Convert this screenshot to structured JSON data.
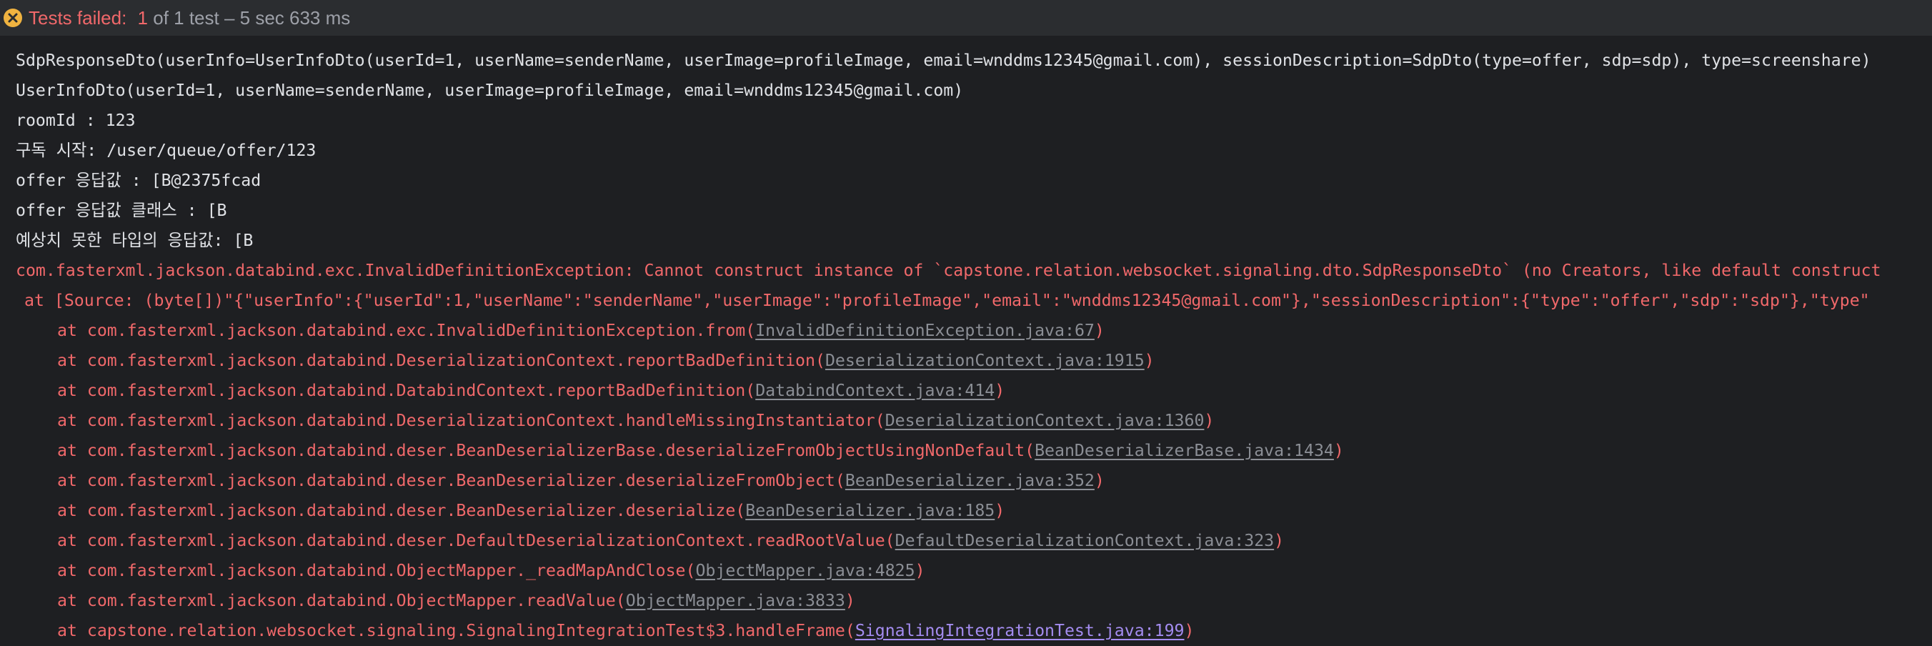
{
  "status": {
    "icon": "error-circle-icon",
    "failed_label": "Tests failed:",
    "failed_count": "1",
    "summary": "of 1 test – 5 sec 633 ms"
  },
  "colors": {
    "background": "#1e1f22",
    "header_bg": "#2b2d30",
    "error": "#f0686a",
    "normal": "#dfe1e5",
    "link": "#8b8e95",
    "link_active": "#a48cf0"
  },
  "console": {
    "output": [
      "SdpResponseDto(userInfo=UserInfoDto(userId=1, userName=senderName, userImage=profileImage, email=wnddms12345@gmail.com), sessionDescription=SdpDto(type=offer, sdp=sdp), type=screenshare)",
      "UserInfoDto(userId=1, userName=senderName, userImage=profileImage, email=wnddms12345@gmail.com)",
      "roomId : 123",
      "구독 시작: /user/queue/offer/123",
      "offer 응답값 : [B@2375fcad",
      "offer 응답값 클래스 : [B",
      "예상치 못한 타입의 응답값: [B"
    ],
    "exception": "com.fasterxml.jackson.databind.exc.InvalidDefinitionException: Cannot construct instance of `capstone.relation.websocket.signaling.dto.SdpResponseDto` (no Creators, like default construct",
    "source": "at [Source: (byte[])\"{\"userInfo\":{\"userId\":1,\"userName\":\"senderName\",\"userImage\":\"profileImage\",\"email\":\"wnddms12345@gmail.com\"},\"sessionDescription\":{\"type\":\"offer\",\"sdp\":\"sdp\"},\"type\"",
    "frames": [
      {
        "method": "at com.fasterxml.jackson.databind.exc.InvalidDefinitionException.from(",
        "link": "InvalidDefinitionException.java:67",
        "tail": ")"
      },
      {
        "method": "at com.fasterxml.jackson.databind.DeserializationContext.reportBadDefinition(",
        "link": "DeserializationContext.java:1915",
        "tail": ")"
      },
      {
        "method": "at com.fasterxml.jackson.databind.DatabindContext.reportBadDefinition(",
        "link": "DatabindContext.java:414",
        "tail": ")"
      },
      {
        "method": "at com.fasterxml.jackson.databind.DeserializationContext.handleMissingInstantiator(",
        "link": "DeserializationContext.java:1360",
        "tail": ")"
      },
      {
        "method": "at com.fasterxml.jackson.databind.deser.BeanDeserializerBase.deserializeFromObjectUsingNonDefault(",
        "link": "BeanDeserializerBase.java:1434",
        "tail": ")"
      },
      {
        "method": "at com.fasterxml.jackson.databind.deser.BeanDeserializer.deserializeFromObject(",
        "link": "BeanDeserializer.java:352",
        "tail": ")"
      },
      {
        "method": "at com.fasterxml.jackson.databind.deser.BeanDeserializer.deserialize(",
        "link": "BeanDeserializer.java:185",
        "tail": ")"
      },
      {
        "method": "at com.fasterxml.jackson.databind.deser.DefaultDeserializationContext.readRootValue(",
        "link": "DefaultDeserializationContext.java:323",
        "tail": ")"
      },
      {
        "method": "at com.fasterxml.jackson.databind.ObjectMapper._readMapAndClose(",
        "link": "ObjectMapper.java:4825",
        "tail": ")"
      },
      {
        "method": "at com.fasterxml.jackson.databind.ObjectMapper.readValue(",
        "link": "ObjectMapper.java:3833",
        "tail": ")"
      },
      {
        "method": "at capstone.relation.websocket.signaling.SignalingIntegrationTest$3.handleFrame(",
        "link": "SignalingIntegrationTest.java:199",
        "tail": ")",
        "active": true
      }
    ]
  }
}
